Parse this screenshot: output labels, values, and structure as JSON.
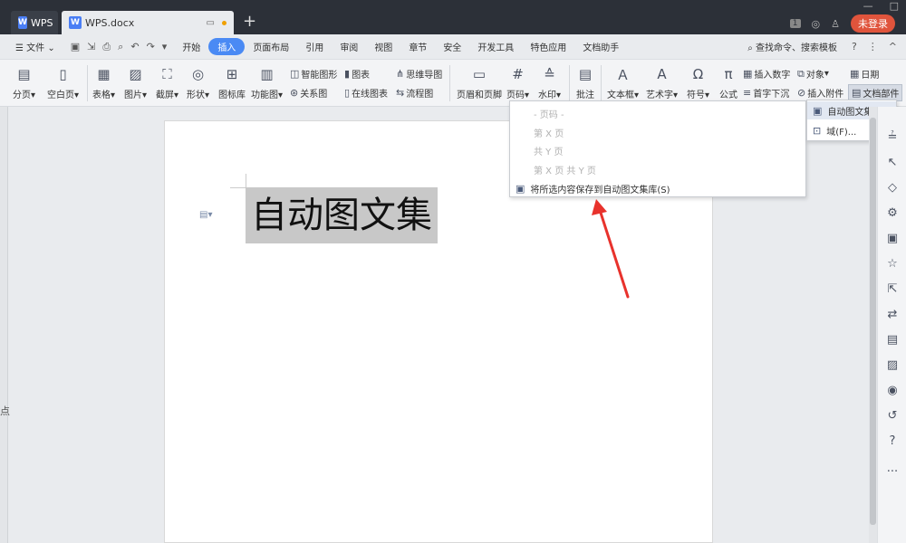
{
  "titlebar": {
    "tabs": [
      {
        "label": "WPS",
        "logo": "W"
      },
      {
        "label": "WPS.docx",
        "logo": "W"
      }
    ],
    "new_tab": "+",
    "badge": "1",
    "login": "未登录"
  },
  "menubar": {
    "hamburger": "☰",
    "file": "文件",
    "items": [
      "开始",
      "插入",
      "页面布局",
      "引用",
      "审阅",
      "视图",
      "章节",
      "安全",
      "开发工具",
      "特色应用",
      "文档助手"
    ],
    "active": "插入",
    "search": "查找命令、搜索模板",
    "help": "?"
  },
  "ribbon": {
    "page_break": "分页",
    "blank_page": "空白页",
    "table": "表格",
    "picture": "图片",
    "screenshot": "截屏",
    "shape": "形状",
    "icon_lib": "图标库",
    "function_chart": "功能图",
    "smart_shape": "智能图形",
    "chart": "图表",
    "mind_map": "思维导图",
    "relation_chart": "关系图",
    "online_chart": "在线图表",
    "flow_chart": "流程图",
    "header_footer": "页眉和页脚",
    "page_number": "页码",
    "watermark": "水印",
    "comment": "批注",
    "textbox": "文本框",
    "wordart": "艺术字",
    "symbol": "符号",
    "formula": "公式",
    "insert_number": "插入数字",
    "object": "对象",
    "date": "日期",
    "drop_cap": "首字下沉",
    "attachment": "插入附件",
    "doc_parts": "文档部件"
  },
  "document": {
    "text": "自动图文集",
    "left_char": "点"
  },
  "dropdown": {
    "items": [
      {
        "label": "- 页码 -",
        "enabled": false
      },
      {
        "label": "第 X 页",
        "enabled": false
      },
      {
        "label": "共 Y 页",
        "enabled": false
      },
      {
        "label": "第 X 页 共 Y 页",
        "enabled": false
      },
      {
        "label": "将所选内容保存到自动图文集库(S)",
        "enabled": true
      }
    ]
  },
  "submenu": {
    "items": [
      "自动图文集(A)",
      "域(F)..."
    ]
  },
  "colors": {
    "accent": "#4a8af4",
    "titlebar": "#2c3038",
    "login": "#e0543c",
    "arrow": "#e8322c"
  }
}
